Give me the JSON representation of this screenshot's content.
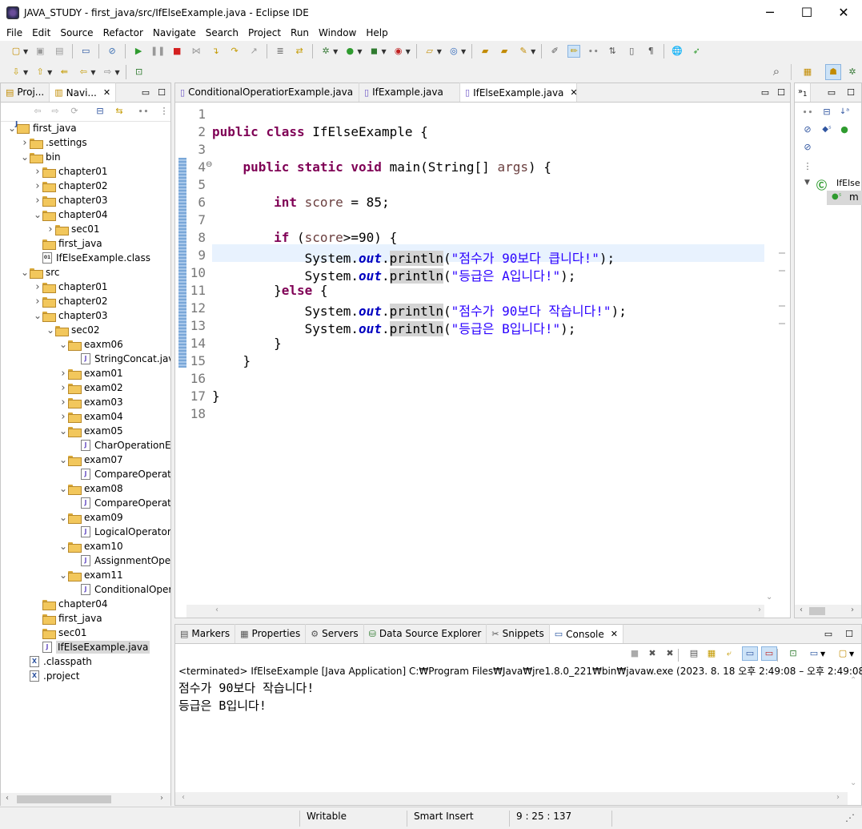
{
  "window": {
    "title": "JAVA_STUDY - first_java/src/IfElseExample.java - Eclipse IDE",
    "controls": [
      "─",
      "☐",
      "✕"
    ]
  },
  "menu": [
    "File",
    "Edit",
    "Source",
    "Refactor",
    "Navigate",
    "Search",
    "Project",
    "Run",
    "Window",
    "Help"
  ],
  "left_panel": {
    "tabs": [
      "Proj...",
      "Navi..."
    ],
    "tree": [
      {
        "label": "first_java",
        "depth": 0,
        "type": "project",
        "expanded": true
      },
      {
        "label": ".settings",
        "depth": 1,
        "type": "folder",
        "expanded": false
      },
      {
        "label": "bin",
        "depth": 1,
        "type": "folder",
        "expanded": true
      },
      {
        "label": "chapter01",
        "depth": 2,
        "type": "folder",
        "expanded": false
      },
      {
        "label": "chapter02",
        "depth": 2,
        "type": "folder",
        "expanded": false
      },
      {
        "label": "chapter03",
        "depth": 2,
        "type": "folder",
        "expanded": false
      },
      {
        "label": "chapter04",
        "depth": 2,
        "type": "folder",
        "expanded": true
      },
      {
        "label": "sec01",
        "depth": 3,
        "type": "folder",
        "expanded": false
      },
      {
        "label": "first_java",
        "depth": 2,
        "type": "folder",
        "leaf": true
      },
      {
        "label": "IfElseExample.class",
        "depth": 2,
        "type": "classfile",
        "leaf": true
      },
      {
        "label": "src",
        "depth": 1,
        "type": "folder",
        "expanded": true
      },
      {
        "label": "chapter01",
        "depth": 2,
        "type": "folder",
        "expanded": false
      },
      {
        "label": "chapter02",
        "depth": 2,
        "type": "folder",
        "expanded": false
      },
      {
        "label": "chapter03",
        "depth": 2,
        "type": "folder",
        "expanded": true
      },
      {
        "label": "sec02",
        "depth": 3,
        "type": "folder",
        "expanded": true
      },
      {
        "label": "eaxm06",
        "depth": 4,
        "type": "folder",
        "expanded": true
      },
      {
        "label": "StringConcat.jav",
        "depth": 5,
        "type": "java",
        "leaf": true
      },
      {
        "label": "exam01",
        "depth": 4,
        "type": "folder",
        "expanded": false
      },
      {
        "label": "exam02",
        "depth": 4,
        "type": "folder",
        "expanded": false
      },
      {
        "label": "exam03",
        "depth": 4,
        "type": "folder",
        "expanded": false
      },
      {
        "label": "exam04",
        "depth": 4,
        "type": "folder",
        "expanded": false
      },
      {
        "label": "exam05",
        "depth": 4,
        "type": "folder",
        "expanded": true
      },
      {
        "label": "CharOperationEx",
        "depth": 5,
        "type": "java",
        "leaf": true
      },
      {
        "label": "exam07",
        "depth": 4,
        "type": "folder",
        "expanded": true
      },
      {
        "label": "CompareOperato",
        "depth": 5,
        "type": "java",
        "leaf": true
      },
      {
        "label": "exam08",
        "depth": 4,
        "type": "folder",
        "expanded": true
      },
      {
        "label": "CompareOperato",
        "depth": 5,
        "type": "java",
        "leaf": true
      },
      {
        "label": "exam09",
        "depth": 4,
        "type": "folder",
        "expanded": true
      },
      {
        "label": "LogicalOperator.",
        "depth": 5,
        "type": "java",
        "leaf": true
      },
      {
        "label": "exam10",
        "depth": 4,
        "type": "folder",
        "expanded": true
      },
      {
        "label": "AssignmentOper",
        "depth": 5,
        "type": "java",
        "leaf": true
      },
      {
        "label": "exam11",
        "depth": 4,
        "type": "folder",
        "expanded": true
      },
      {
        "label": "ConditionalOper",
        "depth": 5,
        "type": "java",
        "leaf": true
      },
      {
        "label": "chapter04",
        "depth": 2,
        "type": "folder",
        "leaf": true
      },
      {
        "label": "first_java",
        "depth": 2,
        "type": "folder",
        "leaf": true
      },
      {
        "label": "sec01",
        "depth": 2,
        "type": "folder",
        "leaf": true
      },
      {
        "label": "IfElseExample.java",
        "depth": 2,
        "type": "java",
        "leaf": true,
        "selected": true
      },
      {
        "label": ".classpath",
        "depth": 1,
        "type": "xfile",
        "leaf": true
      },
      {
        "label": ".project",
        "depth": 1,
        "type": "xfile",
        "leaf": true
      }
    ]
  },
  "editor": {
    "tabs": [
      {
        "label": "ConditionalOperatiorExample.java",
        "active": false
      },
      {
        "label": "IfExample.java",
        "active": false
      },
      {
        "label": "IfElseExample.java",
        "active": true
      }
    ],
    "line_numbers": [
      "1",
      "2",
      "3",
      "4",
      "5",
      "6",
      "7",
      "8",
      "9",
      "10",
      "11",
      "12",
      "13",
      "14",
      "15",
      "16",
      "17",
      "18"
    ],
    "lines": [
      "",
      "public class IfElseExample {",
      "",
      "    public static void main(String[] args) {",
      "",
      "        int score = 85;",
      "",
      "        if (score>=90) {",
      "            System.out.println(\"점수가 90보다 큽니다!\");",
      "            System.out.println(\"등급은 A입니다!\");",
      "        }else {",
      "            System.out.println(\"점수가 90보다 작습니다!\");",
      "            System.out.println(\"등급은 B입니다!\");",
      "        }",
      "    }",
      "",
      "}",
      ""
    ],
    "current_line": 9
  },
  "outline": {
    "class_label": "IfElse",
    "method_label": "m"
  },
  "bottom_panel": {
    "tabs": [
      "Markers",
      "Properties",
      "Servers",
      "Data Source Explorer",
      "Snippets",
      "Console"
    ],
    "active_tab": "Console",
    "console_header": "<terminated> IfElseExample [Java Application] C:₩Program Files₩Java₩jre1.8.0_221₩bin₩javaw.exe  (2023. 8. 18 오후 2:49:08 – 오후 2:49:08)",
    "output": [
      "점수가 90보다 작습니다!",
      "등급은 B입니다!"
    ]
  },
  "status": {
    "writable": "Writable",
    "insert_mode": "Smart Insert",
    "position": "9 : 25 : 137"
  }
}
